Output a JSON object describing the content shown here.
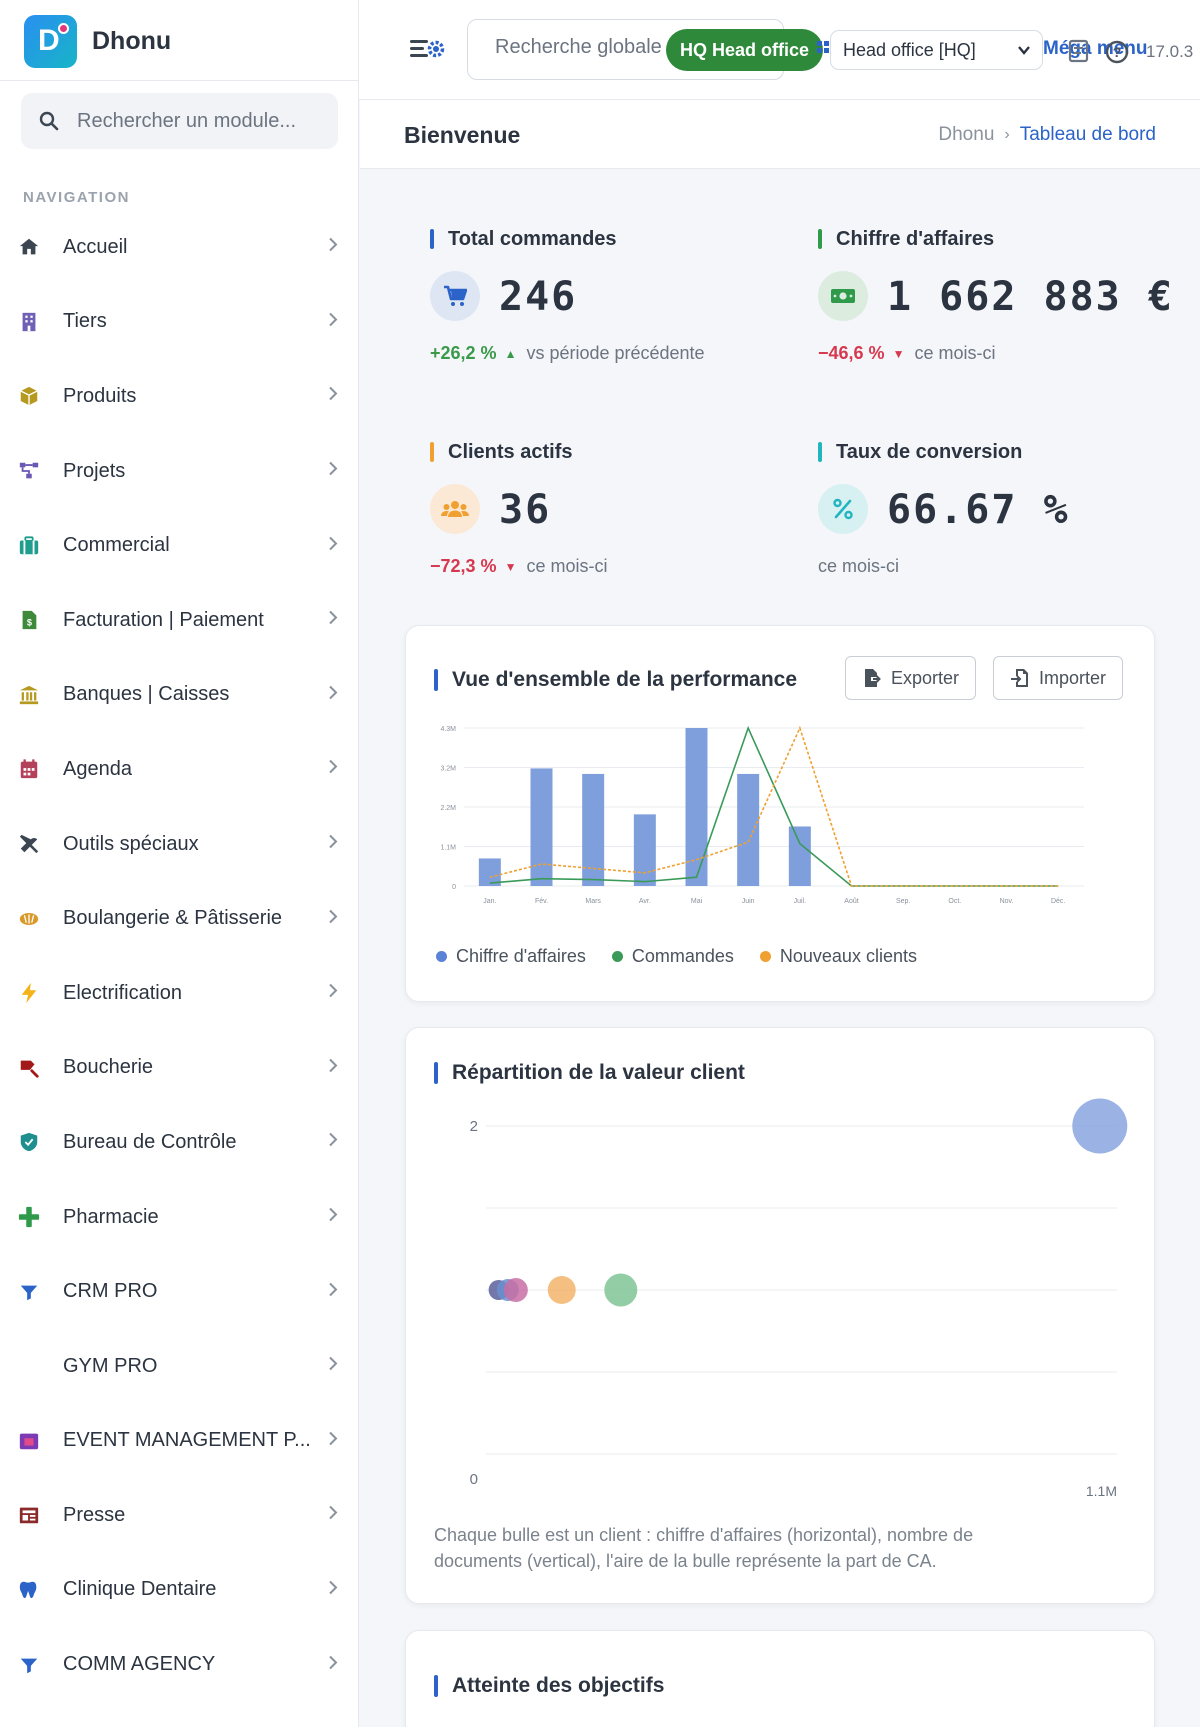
{
  "app": {
    "name": "Dhonu",
    "version": "17.0.3",
    "colors": {
      "accent": "#2b63c9",
      "success": "#2e8a3a",
      "danger": "#d6394f",
      "warning": "#f0a030",
      "teal": "#22b5c0"
    }
  },
  "sidebar": {
    "search_placeholder": "Rechercher un module...",
    "nav_heading": "NAVIGATION",
    "items": [
      {
        "label": "Accueil",
        "icon": "home-icon",
        "icon_color": "#3b4652"
      },
      {
        "label": "Tiers",
        "icon": "building-icon",
        "icon_color": "#6f5fb5"
      },
      {
        "label": "Produits",
        "icon": "box-icon",
        "icon_color": "#b59a1f"
      },
      {
        "label": "Projets",
        "icon": "project-icon",
        "icon_color": "#6b58b5"
      },
      {
        "label": "Commercial",
        "icon": "briefcase-icon",
        "icon_color": "#1f9e8e"
      },
      {
        "label": "Facturation | Paiement",
        "icon": "invoice-icon",
        "icon_color": "#3e8a3a"
      },
      {
        "label": "Banques | Caisses",
        "icon": "bank-icon",
        "icon_color": "#b59a1f"
      },
      {
        "label": "Agenda",
        "icon": "calendar-icon",
        "icon_color": "#b5405a"
      },
      {
        "label": "Outils spéciaux",
        "icon": "tools-icon",
        "icon_color": "#3b4652"
      },
      {
        "label": "Boulangerie & Pâtisserie",
        "icon": "bread-icon",
        "icon_color": "#d99a2b"
      },
      {
        "label": "Electrification",
        "icon": "bolt-icon",
        "icon_color": "#f2b418"
      },
      {
        "label": "Boucherie",
        "icon": "meat-icon",
        "icon_color": "#a31818"
      },
      {
        "label": "Bureau de Contrôle",
        "icon": "shield-icon",
        "icon_color": "#1f8e8e"
      },
      {
        "label": "Pharmacie",
        "icon": "plus-icon",
        "icon_color": "#2e9a4a"
      },
      {
        "label": "CRM PRO",
        "icon": "funnel-icon",
        "icon_color": "#2b63c9"
      },
      {
        "label": "GYM PRO",
        "icon": "",
        "icon_color": ""
      },
      {
        "label": "EVENT MANAGEMENT P...",
        "icon": "event-icon",
        "icon_color": "#7b3bb5"
      },
      {
        "label": "Presse",
        "icon": "newspaper-icon",
        "icon_color": "#8a2a2a"
      },
      {
        "label": "Clinique Dentaire",
        "icon": "tooth-icon",
        "icon_color": "#2b63c9"
      },
      {
        "label": "COMM AGENCY",
        "icon": "funnel-icon",
        "icon_color": "#2b63c9"
      }
    ]
  },
  "topbar": {
    "search_placeholder": "Recherche globale",
    "hq_badge": "HQ Head office",
    "entity_value": "Head office [HQ]",
    "mega_menu": "Méga menu"
  },
  "page": {
    "title": "Bienvenue",
    "breadcrumb_root": "Dhonu",
    "breadcrumb_current": "Tableau de bord"
  },
  "kpis": [
    {
      "title": "Total commandes",
      "value": "246",
      "trend": "+26,2 %",
      "direction": "up",
      "note": "vs période précédente",
      "color": "#2b63c9",
      "icon": "cart-icon"
    },
    {
      "title": "Chiffre d'affaires",
      "value": "1 662 883 €",
      "trend": "−46,6 %",
      "direction": "down",
      "note": "ce mois-ci",
      "color": "#2e9a4a",
      "icon": "money-icon"
    },
    {
      "title": "Clients actifs",
      "value": "36",
      "trend": "−72,3 %",
      "direction": "down",
      "note": "ce mois-ci",
      "color": "#f0a030",
      "icon": "users-icon"
    },
    {
      "title": "Taux de conversion",
      "value": "66.67 %",
      "trend": "",
      "direction": "",
      "note": "ce mois-ci",
      "color": "#22b5c0",
      "icon": "percent-icon"
    }
  ],
  "performance": {
    "title": "Vue d'ensemble de la performance",
    "export_label": "Exporter",
    "import_label": "Importer"
  },
  "bubble": {
    "title": "Répartition de la valeur client",
    "note": "Chaque bulle est un client : chiffre d'affaires (horizontal), nombre de documents (vertical), l'aire de la bulle représente la part de CA."
  },
  "objectives": {
    "title": "Atteinte des objectifs"
  },
  "chart_data": [
    {
      "type": "bar",
      "categories": [
        "Jan.",
        "Fév.",
        "Mars",
        "Avr.",
        "Mai",
        "Juin",
        "Juil.",
        "Août",
        "Sep.",
        "Oct.",
        "Nov.",
        "Déc."
      ],
      "ytick_labels": [
        "0",
        "1.1M",
        "2.2M",
        "3.2M",
        "4.3M"
      ],
      "ylim": [
        0,
        4300000
      ],
      "grid": true,
      "legend_position": "bottom-left",
      "series": [
        {
          "name": "Chiffre d'affaires",
          "type": "bar",
          "color": "#7f9fdc",
          "values": [
            750000,
            3200000,
            3050000,
            1950000,
            4300000,
            3050000,
            1620000,
            0,
            0,
            0,
            0,
            0
          ]
        },
        {
          "name": "Commandes",
          "type": "line",
          "color": "#3a9a5a",
          "dash": false,
          "values": [
            10,
            25,
            22,
            15,
            30,
            540,
            145,
            0,
            0,
            0,
            0,
            0
          ]
        },
        {
          "name": "Nouveaux clients",
          "type": "line",
          "color": "#f0a030",
          "dash": true,
          "values": [
            2,
            5,
            4,
            3,
            6,
            10,
            36,
            0,
            0,
            0,
            0,
            0
          ]
        }
      ]
    },
    {
      "type": "scatter",
      "subtype": "bubble",
      "x_tick_labels": [
        "0",
        "1.1M"
      ],
      "y_tick_labels": [
        "0",
        "2"
      ],
      "xlim": [
        0,
        1100000
      ],
      "ylim": [
        0,
        2
      ],
      "grid": true,
      "points": [
        {
          "x": 1070000,
          "y": 2,
          "size": 55,
          "color": "#8aa4e0"
        },
        {
          "x": 22000,
          "y": 1,
          "size": 20,
          "color": "#5a5f9a"
        },
        {
          "x": 38000,
          "y": 1,
          "size": 22,
          "color": "#6a8fd0"
        },
        {
          "x": 52000,
          "y": 1,
          "size": 24,
          "color": "#c86fa4"
        },
        {
          "x": 132000,
          "y": 1,
          "size": 28,
          "color": "#f2b46a"
        },
        {
          "x": 235000,
          "y": 1,
          "size": 33,
          "color": "#7fc495"
        }
      ]
    }
  ]
}
